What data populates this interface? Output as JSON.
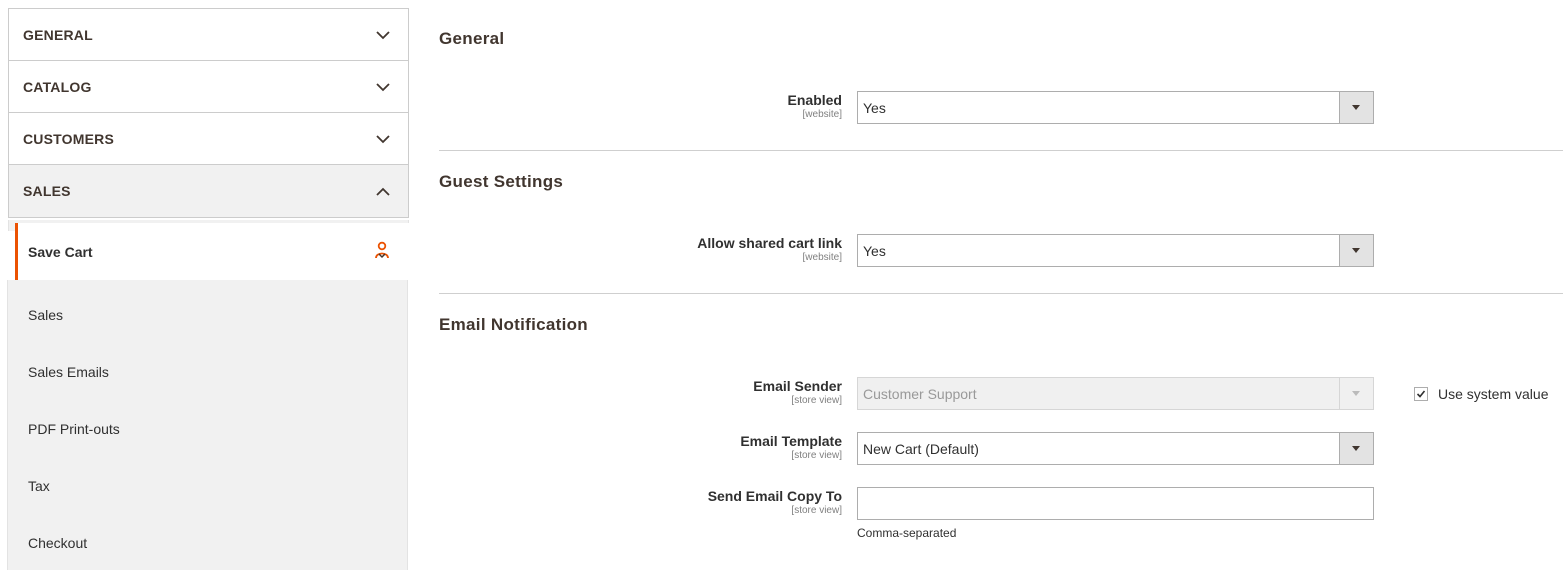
{
  "sidebar": {
    "sections": [
      {
        "label": "GENERAL",
        "icon": "chevron-down-icon"
      },
      {
        "label": "CATALOG",
        "icon": "chevron-down-icon"
      },
      {
        "label": "CUSTOMERS",
        "icon": "chevron-down-icon"
      },
      {
        "label": "SALES",
        "icon": "chevron-up-icon"
      }
    ],
    "active_item": {
      "label": "Save Cart",
      "icon": "vendor-logo-icon"
    },
    "items": [
      "Sales",
      "Sales Emails",
      "PDF Print-outs",
      "Tax",
      "Checkout"
    ]
  },
  "general": {
    "title": "General",
    "enabled_label": "Enabled",
    "enabled_scope": "[website]",
    "enabled_value": "Yes"
  },
  "guest": {
    "title": "Guest Settings",
    "shared_label": "Allow shared cart link",
    "shared_scope": "[website]",
    "shared_value": "Yes"
  },
  "email": {
    "title": "Email Notification",
    "sender_label": "Email Sender",
    "sender_scope": "[store view]",
    "sender_value": "Customer Support",
    "use_system_value": "Use system value",
    "template_label": "Email Template",
    "template_scope": "[store view]",
    "template_value": "New Cart (Default)",
    "copy_label": "Send Email Copy To",
    "copy_scope": "[store view]",
    "copy_value": "",
    "copy_note": "Comma-separated"
  },
  "colors": {
    "accent": "#eb5202",
    "text": "#303030",
    "panel": "#f1f1f1"
  }
}
